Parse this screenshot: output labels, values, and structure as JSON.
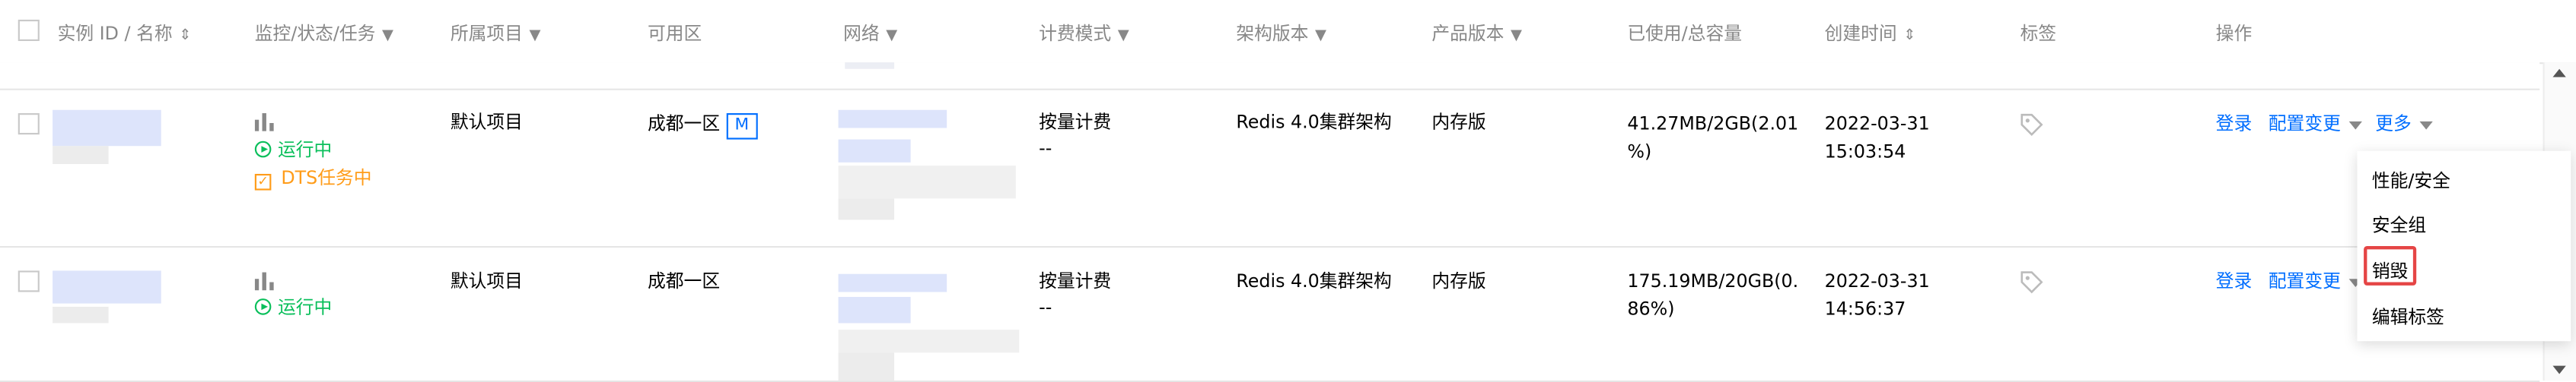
{
  "header": {
    "col_instance": "实例 ID / 名称",
    "col_monitor": "监控/状态/任务",
    "col_project": "所属项目",
    "col_zone": "可用区",
    "col_network": "网络",
    "col_billing": "计费模式",
    "col_arch": "架构版本",
    "col_product": "产品版本",
    "col_capacity": "已使用/总容量",
    "col_created": "创建时间",
    "col_tags": "标签",
    "col_actions": "操作"
  },
  "rows": [
    {
      "status": "运行中",
      "task": "DTS任务中",
      "project": "默认项目",
      "zone": "成都一区",
      "zone_badge": "M",
      "billing": "按量计费",
      "billing_sub": "--",
      "arch": "Redis 4.0集群架构",
      "product": "内存版",
      "capacity_line1": "41.27MB/2GB(2.01",
      "capacity_line2": "%)",
      "created_date": "2022-03-31",
      "created_time": "15:03:54",
      "action_login": "登录",
      "action_config": "配置变更",
      "action_more": "更多"
    },
    {
      "status": "运行中",
      "project": "默认项目",
      "zone": "成都一区",
      "billing": "按量计费",
      "billing_sub": "--",
      "arch": "Redis 4.0集群架构",
      "product": "内存版",
      "capacity_line1": "175.19MB/20GB(0.",
      "capacity_line2": "86%)",
      "created_date": "2022-03-31",
      "created_time": "14:56:37",
      "action_login": "登录",
      "action_config": "配置变更"
    }
  ],
  "dropdown": {
    "items": [
      "性能/安全",
      "安全组",
      "销毁",
      "编辑标签"
    ],
    "highlighted": "销毁"
  },
  "colors": {
    "accent": "#006eff",
    "running": "#0abf5b",
    "task": "#ff9c19",
    "highlight_border": "#e54545"
  }
}
